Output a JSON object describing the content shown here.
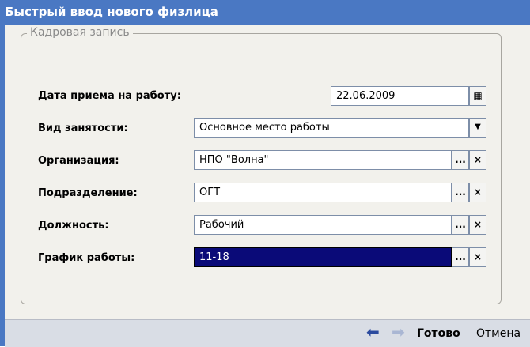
{
  "window": {
    "title": "Быстрый ввод нового физлица"
  },
  "group": {
    "legend": "Кадровая запись"
  },
  "fields": {
    "hire_date": {
      "label": "Дата приема на работу:",
      "value": "22.06.2009"
    },
    "employment_type": {
      "label": "Вид занятости:",
      "value": "Основное место работы"
    },
    "organization": {
      "label": "Организация:",
      "value": "НПО \"Волна\""
    },
    "department": {
      "label": "Подразделение:",
      "value": "ОГТ"
    },
    "position": {
      "label": "Должность:",
      "value": "Рабочий"
    },
    "schedule": {
      "label": "График работы:",
      "value": "11-18"
    }
  },
  "buttons": {
    "ellipsis": "...",
    "clear": "×",
    "dropdown": "▼",
    "calendar": "▦"
  },
  "footer": {
    "back": "⬅",
    "forward": "➡",
    "ready": "Готово",
    "cancel": "Отмена"
  },
  "colors": {
    "titlebar": "#4a78c3",
    "panel": "#f2f1ec",
    "selection": "#0a0a78",
    "nav_arrow_active": "#2b4a9e",
    "nav_arrow_disabled": "#a9b6d3"
  }
}
